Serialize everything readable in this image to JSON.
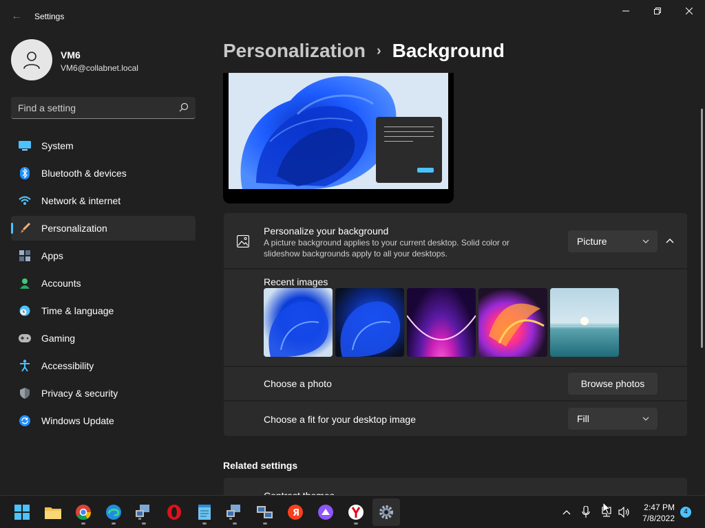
{
  "window": {
    "title": "Settings"
  },
  "user": {
    "name": "VM6",
    "email": "VM6@collabnet.local"
  },
  "search": {
    "placeholder": "Find a setting"
  },
  "sidebar": {
    "items": [
      {
        "label": "System",
        "icon": "monitor-icon"
      },
      {
        "label": "Bluetooth & devices",
        "icon": "bluetooth-icon"
      },
      {
        "label": "Network & internet",
        "icon": "wifi-icon"
      },
      {
        "label": "Personalization",
        "icon": "brush-icon",
        "active": true
      },
      {
        "label": "Apps",
        "icon": "apps-icon"
      },
      {
        "label": "Accounts",
        "icon": "person-icon"
      },
      {
        "label": "Time & language",
        "icon": "clock-globe-icon"
      },
      {
        "label": "Gaming",
        "icon": "gamepad-icon"
      },
      {
        "label": "Accessibility",
        "icon": "accessibility-icon"
      },
      {
        "label": "Privacy & security",
        "icon": "shield-icon"
      },
      {
        "label": "Windows Update",
        "icon": "update-icon"
      }
    ]
  },
  "header": {
    "parent": "Personalization",
    "separator": "›",
    "current": "Background"
  },
  "background": {
    "title": "Personalize your background",
    "description": "A picture background applies to your current desktop. Solid color or slideshow backgrounds apply to all your desktops.",
    "type_value": "Picture",
    "recent_label": "Recent images",
    "recent_images": [
      "bloom-light-blue",
      "bloom-dark-blue",
      "purple-glow",
      "colorful-ribbon",
      "lake-sunrise"
    ],
    "choose_photo_label": "Choose a photo",
    "browse_label": "Browse photos",
    "fit_label": "Choose a fit for your desktop image",
    "fit_value": "Fill"
  },
  "related": {
    "title": "Related settings",
    "first_item": "Contrast themes"
  },
  "taskbar": {
    "apps": [
      "start",
      "file-explorer",
      "chrome",
      "edge",
      "remote-desktop",
      "opera",
      "notepad",
      "network-tool",
      "network-tool-2",
      "yandex-browser",
      "alice",
      "yandex",
      "settings"
    ],
    "time": "2:47 PM",
    "date": "7/8/2022",
    "notifications": "4"
  },
  "colors": {
    "accent": "#4cc2ff",
    "background": "#202020",
    "card": "#2b2b2b"
  }
}
